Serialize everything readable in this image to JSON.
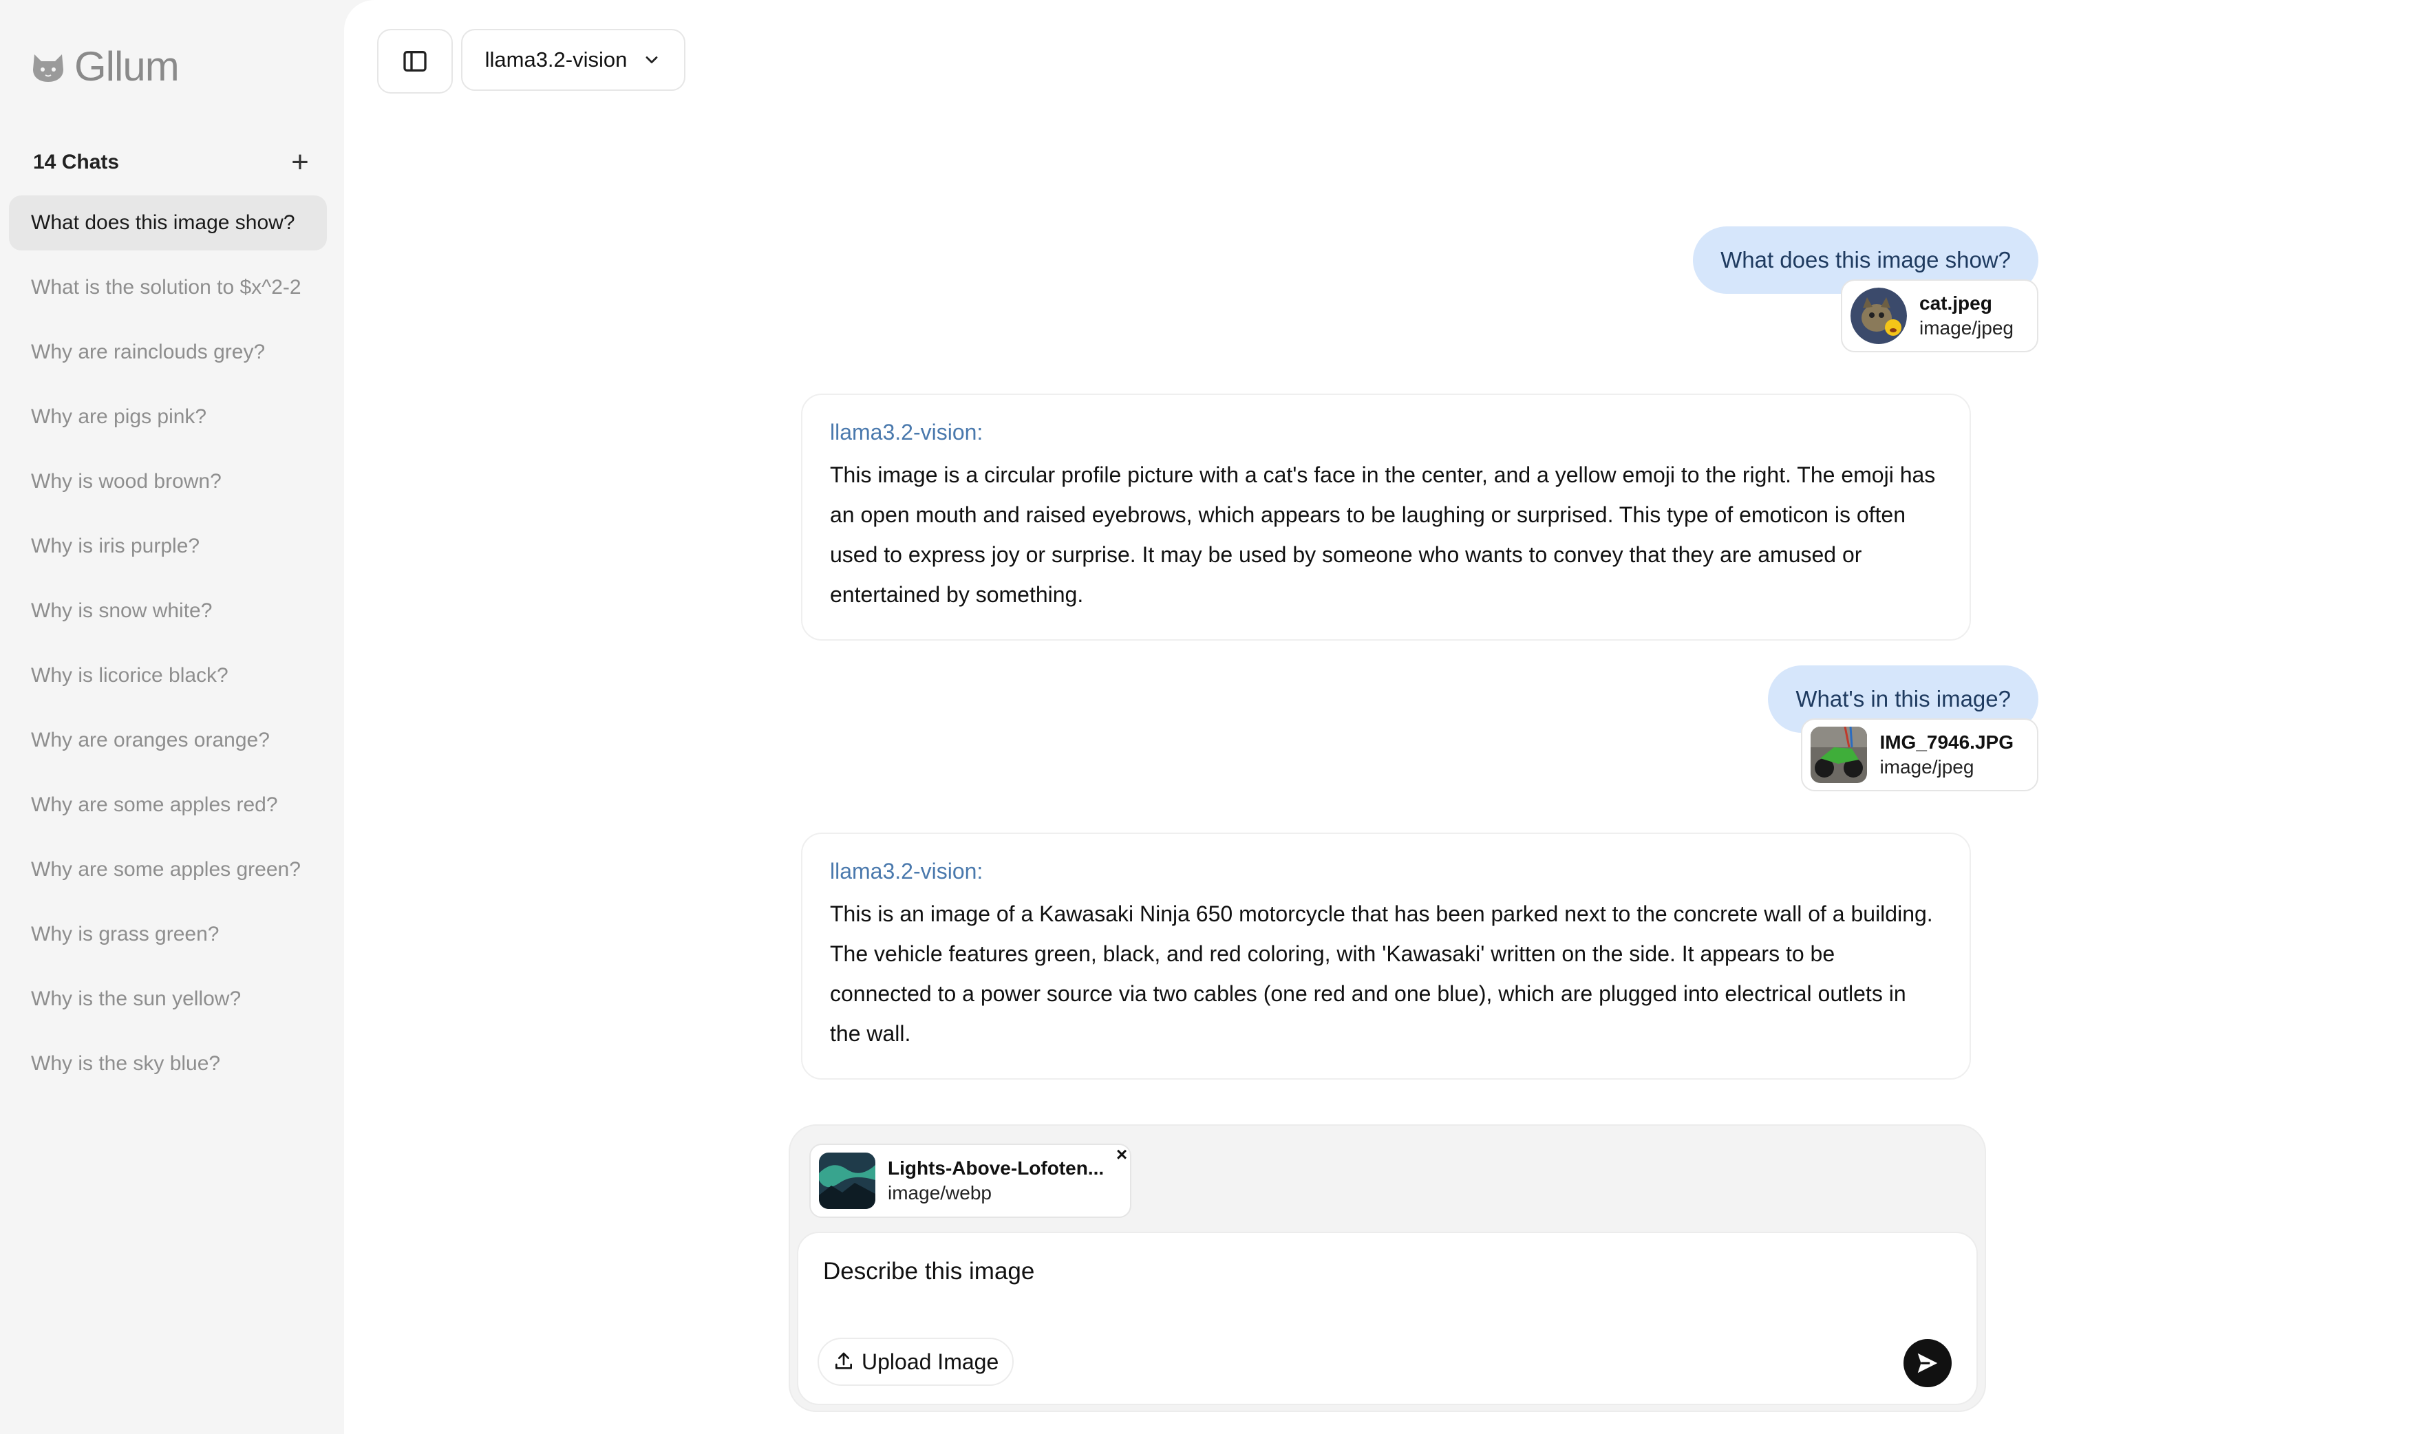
{
  "app": {
    "name": "Gllum",
    "logo_icon": "cat-face-icon"
  },
  "sidebar": {
    "chats_count_label": "14 Chats",
    "new_chat_label": "+",
    "items": [
      {
        "label": "What does this image show?",
        "active": true
      },
      {
        "label": "What is the solution to $x^2-2"
      },
      {
        "label": "Why are rainclouds grey?"
      },
      {
        "label": "Why are pigs pink?"
      },
      {
        "label": "Why is wood brown?"
      },
      {
        "label": "Why is iris purple?"
      },
      {
        "label": "Why is snow white?"
      },
      {
        "label": "Why is licorice black?"
      },
      {
        "label": "Why are oranges orange?"
      },
      {
        "label": "Why are some apples red?"
      },
      {
        "label": "Why are some apples green?"
      },
      {
        "label": "Why is grass green?"
      },
      {
        "label": "Why is the sun yellow?"
      },
      {
        "label": "Why is the sky blue?"
      }
    ]
  },
  "header": {
    "toggle_icon": "sidebar-toggle-icon",
    "model": "llama3.2-vision",
    "dropdown_icon": "chevron-down-icon"
  },
  "messages": [
    {
      "role": "user",
      "text": "What does this image show?",
      "attachment": {
        "name": "cat.jpeg",
        "type": "image/jpeg"
      }
    },
    {
      "role": "assistant",
      "label": "llama3.2-vision:",
      "text": "This image is a circular profile picture with a cat's face in the center, and a yellow emoji to the right. The emoji has an open mouth and raised eyebrows, which appears to be laughing or surprised. This type of emoticon is often used to express joy or surprise. It may be used by someone who wants to convey that they are amused or entertained by something."
    },
    {
      "role": "user",
      "text": "What's in this image?",
      "attachment": {
        "name": "IMG_7946.JPG",
        "type": "image/jpeg"
      }
    },
    {
      "role": "assistant",
      "label": "llama3.2-vision:",
      "text": "This is an image of a Kawasaki Ninja 650 motorcycle that has been parked next to the concrete wall of a building. The vehicle features green, black, and red coloring, with 'Kawasaki' written on the side. It appears to be connected to a power source via two cables (one red and one blue), which are plugged into electrical outlets in the wall."
    }
  ],
  "composer": {
    "pending_attachment": {
      "name": "Lights-Above-Lofoten...",
      "type": "image/webp",
      "remove_label": "×"
    },
    "input_value": "Describe this image",
    "upload_label": "Upload Image",
    "upload_icon": "upload-icon",
    "send_icon": "send-icon"
  },
  "colors": {
    "user_bubble": "#d6e6fb",
    "assistant_label": "#4a79ad",
    "sidebar_bg": "#f5f5f5",
    "send_button": "#111111"
  }
}
